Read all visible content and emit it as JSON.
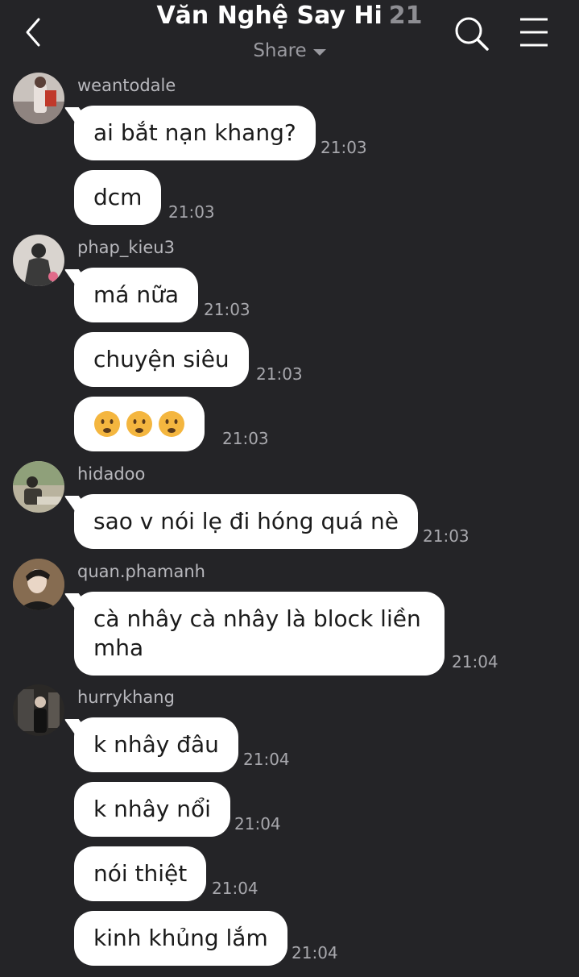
{
  "header": {
    "title": "Văn Nghệ Say Hi",
    "member_count": "21",
    "share_label": "Share",
    "back_icon": "chevron-left-icon",
    "search_icon": "search-icon",
    "menu_icon": "hamburger-menu-icon"
  },
  "messages": [
    {
      "user": "weantodale",
      "text": "ai bắt nạn khang?",
      "time": "21:03"
    },
    {
      "text": "dcm",
      "time": "21:03"
    },
    {
      "user": "phap_kieu3",
      "text": "má nữa",
      "time": "21:03"
    },
    {
      "text": "chuyện siêu",
      "time": "21:03"
    },
    {
      "emoji": "frowning-face-emoji x3",
      "time": "21:03"
    },
    {
      "user": "hidadoo",
      "text": "sao v nói lẹ đi hóng quá nè",
      "time": "21:03"
    },
    {
      "user": "quan.phamanh",
      "text": "cà nhây cà nhây là block liền mha",
      "time": "21:04"
    },
    {
      "user": "hurrykhang",
      "text": "k nhây đâu",
      "time": "21:04"
    },
    {
      "text": "k nhây nổi",
      "time": "21:04"
    },
    {
      "text": "nói thiệt",
      "time": "21:04"
    },
    {
      "text": "kinh khủng lắm",
      "time": "21:04"
    }
  ],
  "colors": {
    "background": "#242427",
    "bubble": "#ffffff",
    "timestamp": "#a8a8ad",
    "username": "#b8b8bd"
  }
}
